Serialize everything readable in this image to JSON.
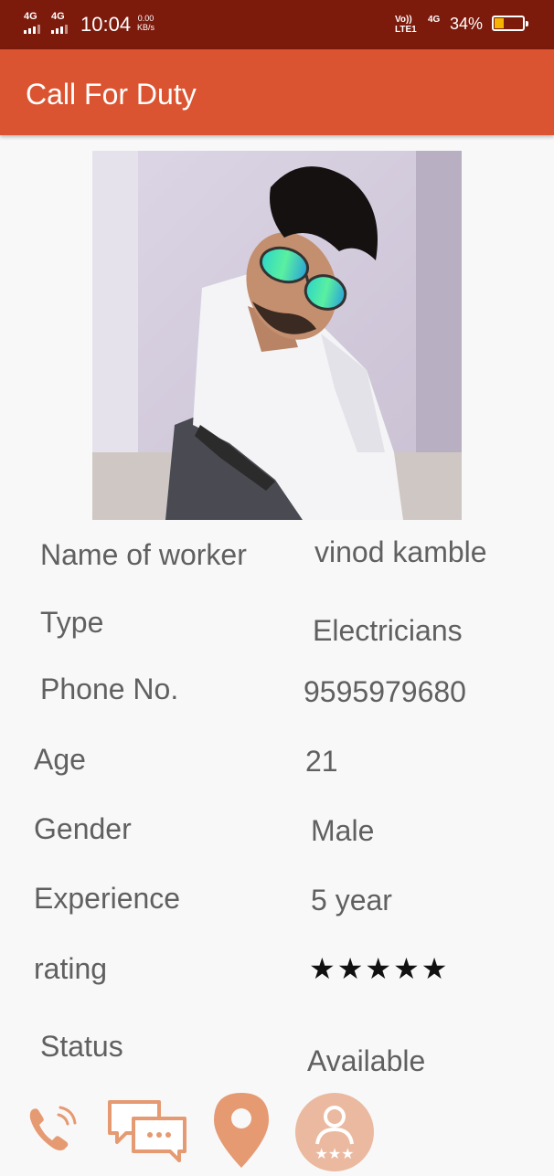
{
  "status_bar": {
    "sim1": "4G",
    "sim2": "4G",
    "time": "10:04",
    "speed_value": "0.00",
    "speed_unit": "KB/s",
    "volte_top": "Vo))",
    "volte_bottom": "LTE1",
    "network": "4G",
    "battery_percent": "34%",
    "battery_level": 0.34
  },
  "app_bar": {
    "title": "Call For Duty"
  },
  "worker": {
    "fields": [
      {
        "label": "Name of worker",
        "value": "vinod kamble"
      },
      {
        "label": "Type",
        "value": "Electricians"
      },
      {
        "label": "Phone No.",
        "value": "9595979680"
      },
      {
        "label": "Age",
        "value": "21"
      },
      {
        "label": "Gender",
        "value": "Male"
      },
      {
        "label": "Experience",
        "value": "5 year"
      },
      {
        "label": "rating",
        "value": "★★★★★"
      },
      {
        "label": "Status",
        "value": "Available"
      }
    ],
    "rating_stars": 5
  },
  "actions": [
    {
      "icon": "phone-icon"
    },
    {
      "icon": "chat-icon"
    },
    {
      "icon": "location-pin-icon"
    },
    {
      "icon": "rate-worker-icon"
    }
  ],
  "colors": {
    "status_bar": "#7c1a0c",
    "app_bar": "#db5432",
    "icon_accent": "#e59a72"
  }
}
